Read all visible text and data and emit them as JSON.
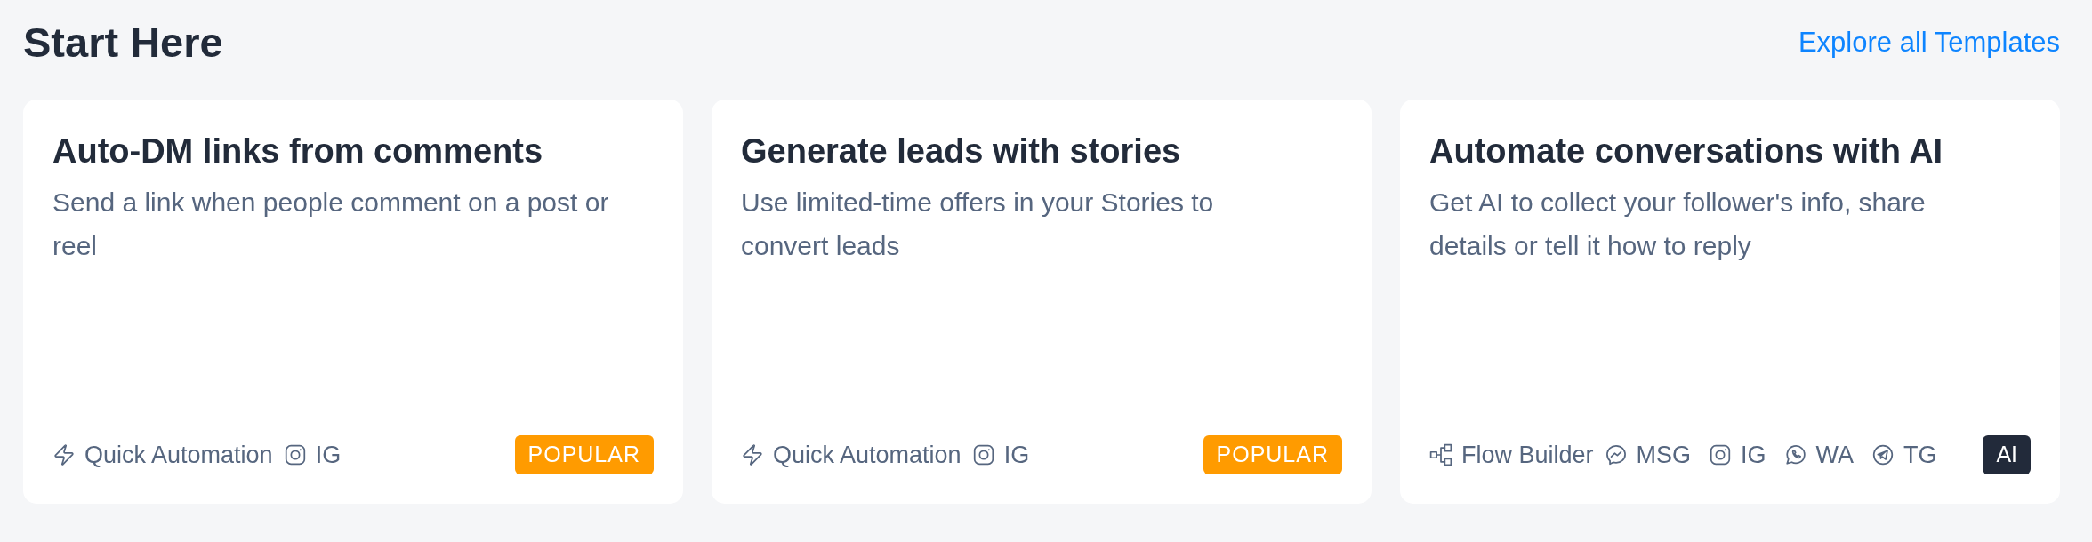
{
  "header": {
    "title": "Start Here",
    "link": "Explore all Templates"
  },
  "cards": [
    {
      "title": "Auto-DM links from comments",
      "description": "Send a link when people comment on a post or reel",
      "type": {
        "kind": "quick",
        "label": "Quick Automation"
      },
      "channels": [
        {
          "kind": "instagram",
          "label": "IG"
        }
      ],
      "badge": {
        "kind": "popular",
        "label": "POPULAR"
      }
    },
    {
      "title": "Generate leads with stories",
      "description": "Use limited-time offers in your Stories to convert leads",
      "type": {
        "kind": "quick",
        "label": "Quick Automation"
      },
      "channels": [
        {
          "kind": "instagram",
          "label": "IG"
        }
      ],
      "badge": {
        "kind": "popular",
        "label": "POPULAR"
      }
    },
    {
      "title": "Automate conversations with AI",
      "description": "Get AI to collect your follower's info, share details or tell it how to reply",
      "type": {
        "kind": "flow",
        "label": "Flow Builder"
      },
      "channels": [
        {
          "kind": "messenger",
          "label": "MSG"
        },
        {
          "kind": "instagram",
          "label": "IG"
        },
        {
          "kind": "whatsapp",
          "label": "WA"
        },
        {
          "kind": "telegram",
          "label": "TG"
        }
      ],
      "badge": {
        "kind": "ai",
        "label": "AI"
      }
    }
  ]
}
